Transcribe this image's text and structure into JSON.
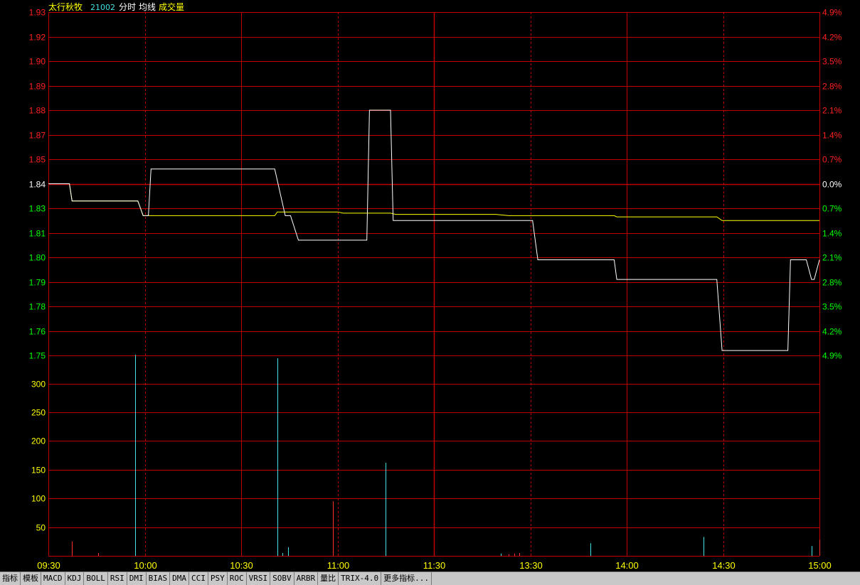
{
  "header": {
    "stock_name": "太行秋牧",
    "stock_code": "21002",
    "mode": "分时",
    "avg_label": "均线",
    "volume_label": "成交量"
  },
  "colors": {
    "price_line": "#ffffff",
    "avg_line": "#ffff00",
    "grid": "#c00000",
    "up_label": "#ff2020",
    "down_label": "#00ff00",
    "base_label": "#ffffff",
    "volume_label": "#ffff00",
    "vol_up": "#ff3030",
    "vol_down": "#40e0e0"
  },
  "chart_data": {
    "type": "line",
    "x_ticks": [
      "09:30",
      "10:00",
      "10:30",
      "11:00",
      "11:30",
      "13:30",
      "14:00",
      "14:30",
      "15:00"
    ],
    "price_ticks": [
      {
        "label": "1.93",
        "price": 1.93,
        "pct": "4.9%",
        "dir": "up"
      },
      {
        "label": "1.92",
        "price": 1.92,
        "pct": "4.2%",
        "dir": "up"
      },
      {
        "label": "1.90",
        "price": 1.9,
        "pct": "3.5%",
        "dir": "up"
      },
      {
        "label": "1.89",
        "price": 1.89,
        "pct": "2.8%",
        "dir": "up"
      },
      {
        "label": "1.88",
        "price": 1.88,
        "pct": "2.1%",
        "dir": "up"
      },
      {
        "label": "1.87",
        "price": 1.87,
        "pct": "1.4%",
        "dir": "up"
      },
      {
        "label": "1.85",
        "price": 1.85,
        "pct": "0.7%",
        "dir": "up"
      },
      {
        "label": "1.84",
        "price": 1.84,
        "pct": "0.0%",
        "dir": "base"
      },
      {
        "label": "1.83",
        "price": 1.83,
        "pct": "0.7%",
        "dir": "down"
      },
      {
        "label": "1.81",
        "price": 1.81,
        "pct": "1.4%",
        "dir": "down"
      },
      {
        "label": "1.80",
        "price": 1.8,
        "pct": "2.1%",
        "dir": "down"
      },
      {
        "label": "1.79",
        "price": 1.79,
        "pct": "2.8%",
        "dir": "down"
      },
      {
        "label": "1.78",
        "price": 1.78,
        "pct": "3.5%",
        "dir": "down"
      },
      {
        "label": "1.76",
        "price": 1.76,
        "pct": "4.2%",
        "dir": "down"
      },
      {
        "label": "1.75",
        "price": 1.75,
        "pct": "4.9%",
        "dir": "down"
      }
    ],
    "volume_ticks": [
      "300",
      "250",
      "200",
      "150",
      "100",
      "50"
    ],
    "price_range": [
      1.75,
      1.93
    ],
    "volume_range": [
      0,
      350
    ],
    "series": [
      {
        "name": "分时",
        "points": [
          [
            0,
            1.84
          ],
          [
            8,
            1.84
          ],
          [
            9,
            1.833
          ],
          [
            34,
            1.833
          ],
          [
            36,
            1.824
          ],
          [
            38,
            1.824
          ],
          [
            39,
            1.846
          ],
          [
            86,
            1.846
          ],
          [
            90,
            1.824
          ],
          [
            92,
            1.824
          ],
          [
            95,
            1.807
          ],
          [
            121,
            1.807
          ],
          [
            122,
            1.88
          ],
          [
            130,
            1.88
          ],
          [
            131,
            1.82
          ],
          [
            184,
            1.82
          ],
          [
            186,
            1.799
          ],
          [
            215,
            1.799
          ],
          [
            216,
            1.791
          ],
          [
            254,
            1.791
          ],
          [
            256,
            1.752
          ],
          [
            281,
            1.752
          ],
          [
            282,
            1.799
          ],
          [
            288,
            1.799
          ],
          [
            290,
            1.791
          ],
          [
            291,
            1.791
          ],
          [
            293,
            1.799
          ]
        ]
      },
      {
        "name": "均线",
        "points": [
          [
            0,
            1.84
          ],
          [
            8,
            1.84
          ],
          [
            9,
            1.833
          ],
          [
            34,
            1.833
          ],
          [
            36,
            1.824
          ],
          [
            86,
            1.824
          ],
          [
            87,
            1.827
          ],
          [
            110,
            1.827
          ],
          [
            112,
            1.826
          ],
          [
            130,
            1.826
          ],
          [
            132,
            1.825
          ],
          [
            170,
            1.825
          ],
          [
            175,
            1.824
          ],
          [
            215,
            1.824
          ],
          [
            216,
            1.823
          ],
          [
            254,
            1.823
          ],
          [
            256,
            1.82
          ],
          [
            290,
            1.82
          ],
          [
            293,
            1.82
          ]
        ]
      }
    ],
    "volume": [
      {
        "t": 9,
        "v": 25,
        "dir": "up"
      },
      {
        "t": 19,
        "v": 5,
        "dir": "up"
      },
      {
        "t": 33,
        "v": 350,
        "dir": "down"
      },
      {
        "t": 87,
        "v": 344,
        "dir": "down"
      },
      {
        "t": 89,
        "v": 5,
        "dir": "down"
      },
      {
        "t": 91,
        "v": 15,
        "dir": "down"
      },
      {
        "t": 108,
        "v": 95,
        "dir": "up"
      },
      {
        "t": 128,
        "v": 162,
        "dir": "down"
      },
      {
        "t": 172,
        "v": 4,
        "dir": "down"
      },
      {
        "t": 175,
        "v": 3,
        "dir": "up"
      },
      {
        "t": 177,
        "v": 4,
        "dir": "up"
      },
      {
        "t": 179,
        "v": 5,
        "dir": "up"
      },
      {
        "t": 206,
        "v": 22,
        "dir": "down"
      },
      {
        "t": 249,
        "v": 33,
        "dir": "down"
      },
      {
        "t": 290,
        "v": 17,
        "dir": "down"
      },
      {
        "t": 293,
        "v": 28,
        "dir": "up"
      }
    ]
  },
  "tabs": [
    "指标",
    "模板",
    "MACD",
    "KDJ",
    "BOLL",
    "RSI",
    "DMI",
    "BIAS",
    "DMA",
    "CCI",
    "PSY",
    "ROC",
    "VRSI",
    "SOBV",
    "ARBR",
    "量比",
    "TRIX-4.0",
    "更多指标..."
  ]
}
